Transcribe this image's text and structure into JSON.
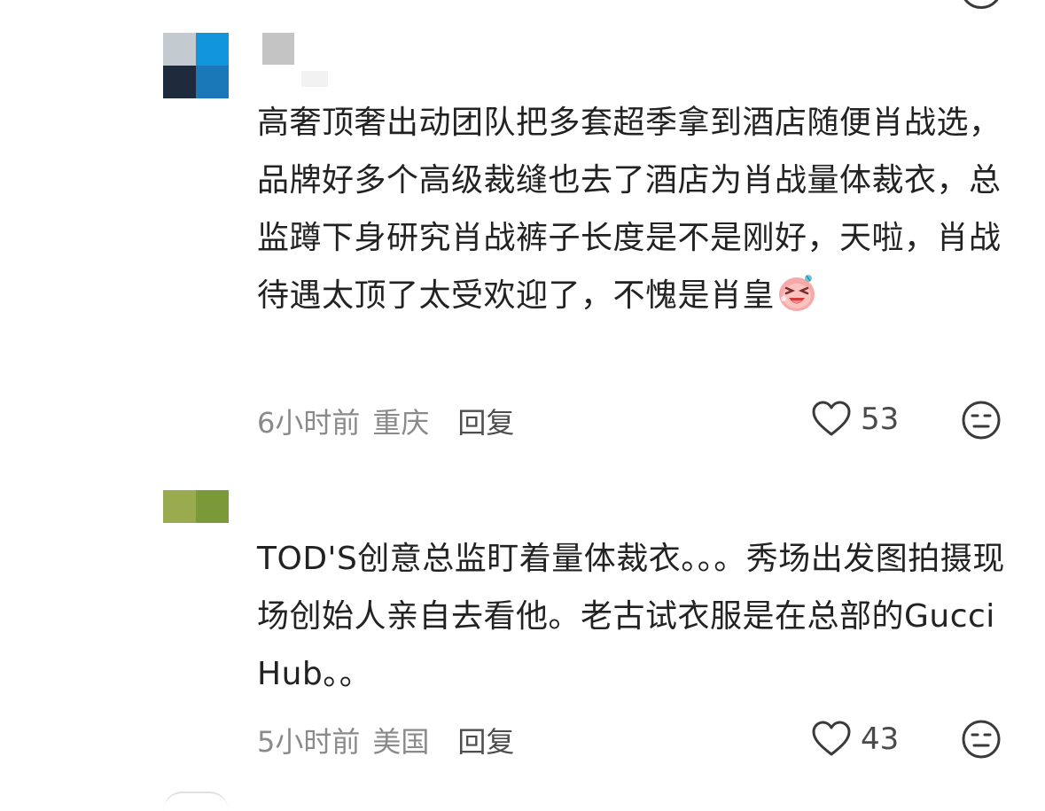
{
  "comments": [
    {
      "username": "",
      "text": "高奢顶奢出动团队把多套超季拿到酒店随便肖战选，品牌好多个高级裁缝也去了酒店为肖战量体裁衣，总监蹲下身研究肖战裤子长度是不是刚好，天啦，肖战待遇太顶了太受欢迎了，不愧是肖皇",
      "emoji": "crying-laughing-face-emoji",
      "time": "6小时前",
      "location": "重庆",
      "reply_label": "回复",
      "likes": "53",
      "avatar_colors": [
        "#c3cad0",
        "#1296db",
        "#1e2b3c",
        "#1a78b8"
      ]
    },
    {
      "username": "",
      "text": "TOD'S创意总监盯着量体裁衣。。。秀场出发图拍摄现场创始人亲自去看他。老古试衣服是在总部的Gucci Hub。。",
      "time": "5小时前",
      "location": "美国",
      "reply_label": "回复",
      "likes": "43",
      "avatar_colors": [
        "#9aab4f",
        "#7a9a3a"
      ]
    }
  ],
  "icons": {
    "like": "heart-outline-icon",
    "react": "neutral-face-icon"
  },
  "colors": {
    "text": "#222222",
    "meta": "#8a8a8a",
    "reply": "#4d4d4d",
    "icon": "#3a3a3a"
  }
}
